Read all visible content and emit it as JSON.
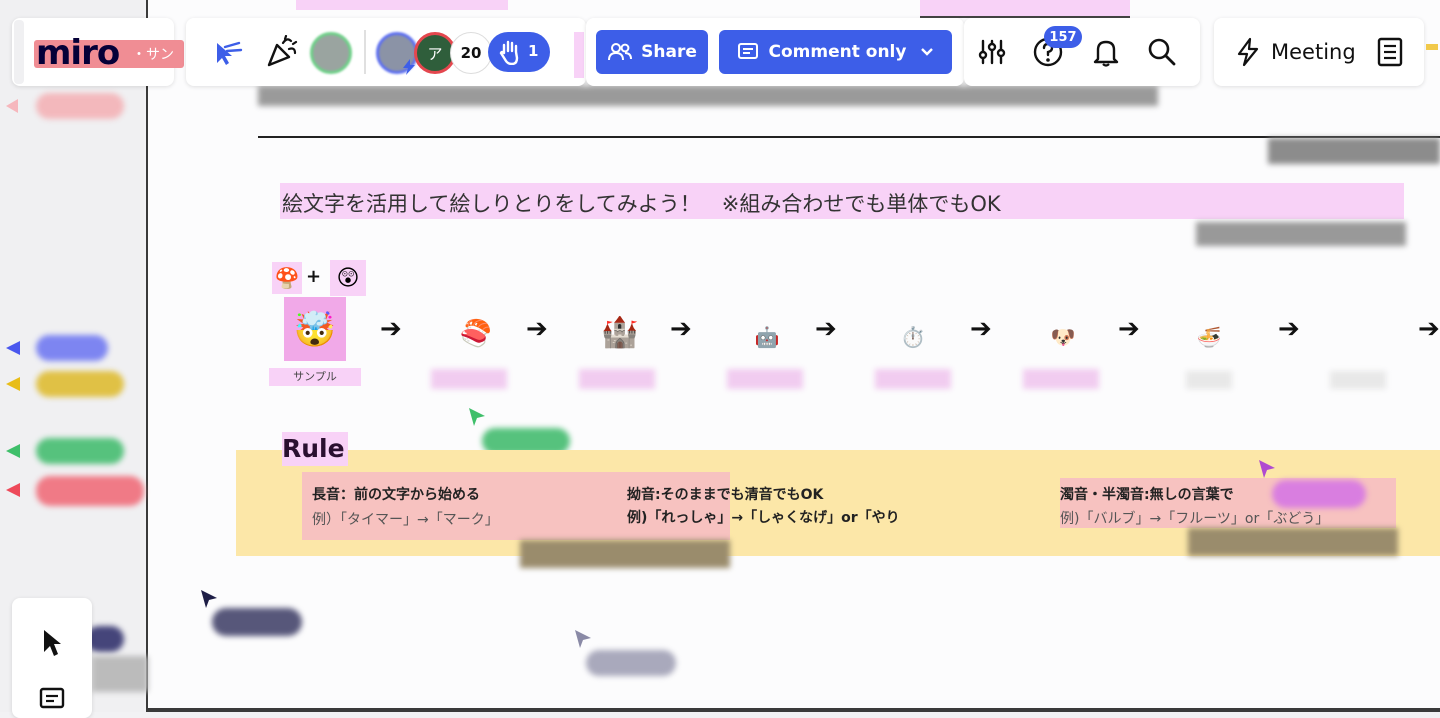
{
  "brand": {
    "logo": "miro",
    "board_name_fragment": "・サン"
  },
  "toolbar": {
    "collaborator_count": "20",
    "raised_hands": "1",
    "share_label": "Share",
    "comment_mode_label": "Comment only",
    "notification_count": "157",
    "meeting_label": "Meeting",
    "avatar_initial": "ア"
  },
  "board": {
    "instruction": "絵文字を活用して絵しりとりをしてみよう！　※組み合わせでも単体でもOK",
    "combo_plus": "+",
    "combo_left": "🍄",
    "combo_right": "😲",
    "chain": [
      {
        "emoji": "🤯",
        "label": "サンプル"
      },
      {
        "emoji": "🍣",
        "label": ""
      },
      {
        "emoji": "🏰",
        "label": ""
      },
      {
        "emoji": "🤖",
        "label": ""
      },
      {
        "emoji": "⏱️",
        "label": ""
      },
      {
        "emoji": "🐶",
        "label": ""
      },
      {
        "emoji": "🍜",
        "label": ""
      }
    ],
    "arrow": "➔"
  },
  "rules": {
    "heading": "Rule",
    "r1_title": "長音：前の文字から始める",
    "r1_example": "例）「タイマー」→「マーク」",
    "r2_title": "拗音:そのままでも清音でもOK",
    "r2_example": "例)「れっしゃ」→「しゃくなげ」or「やり",
    "r3_title": "濁音・半濁音:無しの言葉で",
    "r3_example": "例)「バルブ」→「フルーツ」or「ぶどう」"
  },
  "colors": {
    "accent": "#3d5ee8",
    "sticky_pink": "#f8d2f7",
    "rule_bg": "#fce7a8",
    "rule_card": "#f7c2c0"
  }
}
